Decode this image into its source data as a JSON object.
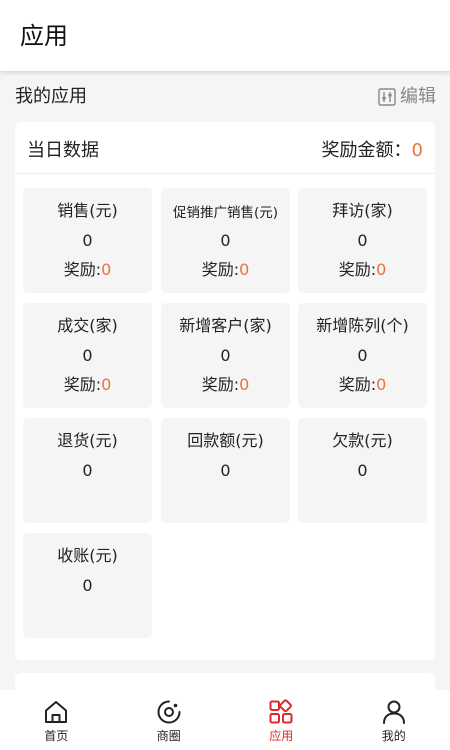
{
  "header": {
    "title": "应用"
  },
  "section": {
    "title": "我的应用",
    "edit_label": "编辑"
  },
  "card": {
    "title": "当日数据",
    "reward_label": "奖励金额：",
    "reward_value": "0",
    "tiles": [
      {
        "label": "销售(元)",
        "value": "0",
        "reward_label": "奖励:",
        "reward_value": "0"
      },
      {
        "label": "促销推广销售(元)",
        "value": "0",
        "reward_label": "奖励:",
        "reward_value": "0"
      },
      {
        "label": "拜访(家)",
        "value": "0",
        "reward_label": "奖励:",
        "reward_value": "0"
      },
      {
        "label": "成交(家)",
        "value": "0",
        "reward_label": "奖励:",
        "reward_value": "0"
      },
      {
        "label": "新增客户(家)",
        "value": "0",
        "reward_label": "奖励:",
        "reward_value": "0"
      },
      {
        "label": "新增陈列(个)",
        "value": "0",
        "reward_label": "奖励:",
        "reward_value": "0"
      },
      {
        "label": "退货(元)",
        "value": "0"
      },
      {
        "label": "回款额(元)",
        "value": "0"
      },
      {
        "label": "欠款(元)",
        "value": "0"
      },
      {
        "label": "收账(元)",
        "value": "0"
      }
    ]
  },
  "tabbar": {
    "items": [
      {
        "label": "首页",
        "icon": "home-icon"
      },
      {
        "label": "商圈",
        "icon": "business-circle-icon"
      },
      {
        "label": "应用",
        "icon": "apps-icon",
        "active": true
      },
      {
        "label": "我的",
        "icon": "user-icon"
      }
    ]
  },
  "colors": {
    "accent": "#f0703a",
    "active_tab": "#e02828"
  }
}
